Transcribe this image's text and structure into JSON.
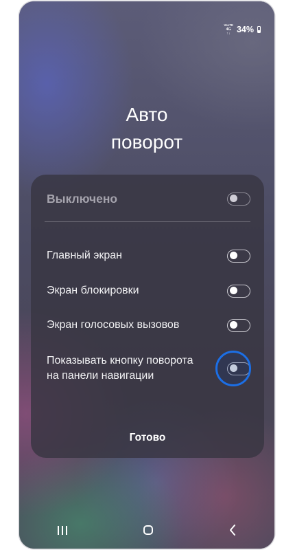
{
  "status_bar": {
    "signal_top": "VoLTE",
    "signal_mid": "4G",
    "signal_arrows": "↑↓",
    "battery_percent": "34%"
  },
  "dialog": {
    "title_line1": "Авто",
    "title_line2": "поворот",
    "master": {
      "label": "Выключено",
      "on": false,
      "enabled": false
    },
    "options": [
      {
        "label": "Главный экран",
        "on": false
      },
      {
        "label": "Экран блокировки",
        "on": false
      },
      {
        "label": "Экран голосовых вызовов",
        "on": false
      },
      {
        "label_line1": "Показывать кнопку поворота",
        "label_line2": "на панели навигации",
        "on": false,
        "highlighted": true
      }
    ],
    "done_label": "Готово"
  },
  "colors": {
    "highlight_ring": "#1c6fe6",
    "panel": "#383642",
    "text": "#f2f2f4"
  },
  "navbar": {
    "recent_icon": "recent-apps-icon",
    "home_icon": "home-icon",
    "back_icon": "back-icon"
  }
}
